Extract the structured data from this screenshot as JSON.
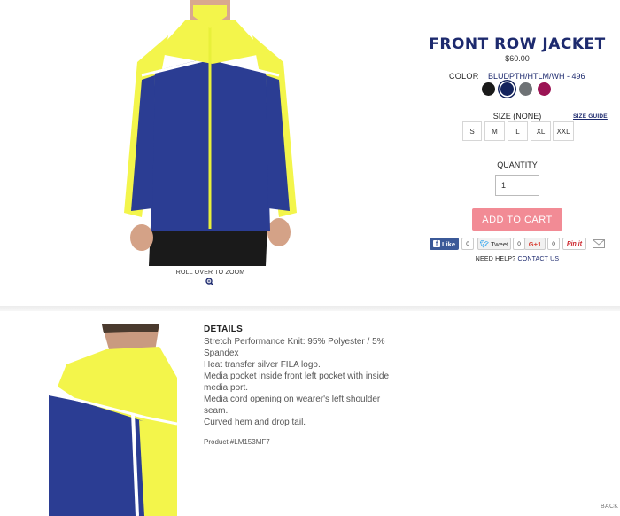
{
  "product": {
    "title": "FRONT ROW JACKET",
    "price": "$60.00",
    "zoom_text": "ROLL OVER TO ZOOM"
  },
  "color": {
    "label": "COLOR",
    "selected_name": "BLUDPTH/HTLM/WH - 496",
    "swatches": [
      {
        "name": "black",
        "hex": "#1a1a1a"
      },
      {
        "name": "navy",
        "hex": "#14235c"
      },
      {
        "name": "grey",
        "hex": "#6e7275"
      },
      {
        "name": "magenta",
        "hex": "#9b1454"
      }
    ],
    "selected_index": 1
  },
  "size": {
    "label": "SIZE (NONE)",
    "guide_label": "SIZE GUIDE",
    "options": [
      "S",
      "M",
      "L",
      "XL",
      "XXL"
    ]
  },
  "quantity": {
    "label": "QUANTITY",
    "value": "1"
  },
  "cart": {
    "add_label": "ADD TO CART"
  },
  "social": {
    "like_label": "Like",
    "like_count": "0",
    "tweet_label": "Tweet",
    "tweet_count": "0",
    "gplus_label": "G+1",
    "gplus_count": "0",
    "pin_label": "Pin it",
    "icons": [
      "facebook-icon",
      "twitter-icon",
      "google-plus-icon",
      "pinterest-icon",
      "mail-icon"
    ]
  },
  "help": {
    "text": "NEED HELP?",
    "link": "CONTACT US"
  },
  "details": {
    "title": "DETAILS",
    "lines": [
      "Stretch Performance Knit: 95% Polyester / 5%",
      "Spandex",
      "Heat transfer silver FILA logo.",
      "Media pocket inside front left pocket with inside",
      "media port.",
      "Media cord opening on wearer's left shoulder",
      "seam.",
      "Curved hem and drop tail."
    ],
    "product_code": "Product #LM153MF7"
  },
  "footer": {
    "back_label": "BACK"
  },
  "colors": {
    "brand_navy": "#1d2a6e",
    "add_to_cart": "#f28b95",
    "jacket_blue": "#2b3d93",
    "jacket_yellow": "#f3f54b"
  }
}
